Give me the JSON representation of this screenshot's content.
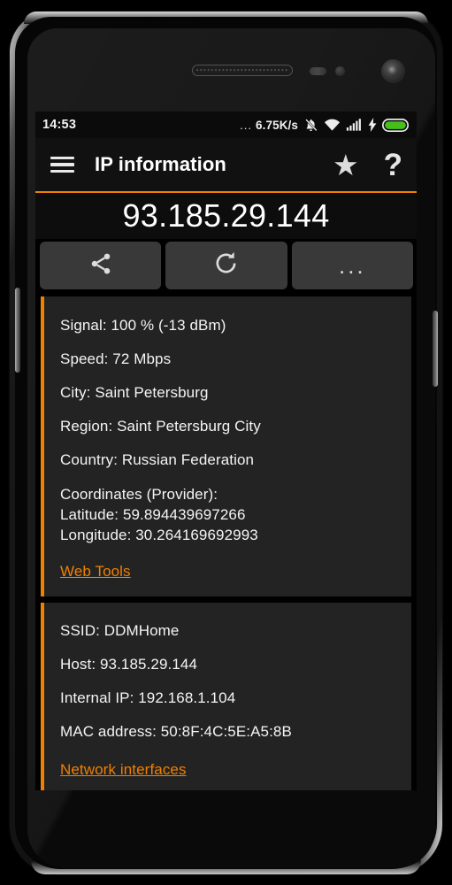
{
  "statusbar": {
    "clock": "14:53",
    "dots": "...",
    "network_speed": "6.75K/s",
    "icons": [
      "silent-bell-icon",
      "wifi-icon",
      "cellular-signal-icon",
      "charging-bolt-icon",
      "battery-icon"
    ]
  },
  "actionbar": {
    "menu_icon": "hamburger-menu-icon",
    "title": "IP information",
    "favorite_icon": "star-icon",
    "help_icon": "question-mark-icon",
    "accent_color": "#f08000"
  },
  "ip_header": {
    "ip_address": "93.185.29.144"
  },
  "buttons": [
    {
      "name": "share",
      "icon": "share-icon",
      "label": ""
    },
    {
      "name": "refresh",
      "icon": "refresh-icon",
      "label": ""
    },
    {
      "name": "more",
      "icon": "more-dots-icon",
      "label": "..."
    }
  ],
  "cards": [
    {
      "name": "connection-info-card",
      "rows": [
        "Signal: 100 % (-13 dBm)",
        "Speed: 72 Mbps",
        "City: Saint Petersburg",
        "Region: Saint Petersburg City",
        "Country: Russian Federation"
      ],
      "coordinates": {
        "title": "Coordinates (Provider):",
        "latitude": "Latitude: 59.894439697266",
        "longitude": "Longitude: 30.264169692993"
      },
      "link": "Web Tools"
    },
    {
      "name": "network-info-card",
      "rows": [
        "SSID: DDMHome",
        "Host: 93.185.29.144",
        "Internal IP: 192.168.1.104",
        "MAC address: 50:8F:4C:5E:A5:8B"
      ],
      "link": "Network interfaces"
    }
  ],
  "colors": {
    "accent": "#f08000",
    "card_bg": "#232323",
    "screen_bg": "#000000",
    "battery_green": "#45c01a"
  }
}
